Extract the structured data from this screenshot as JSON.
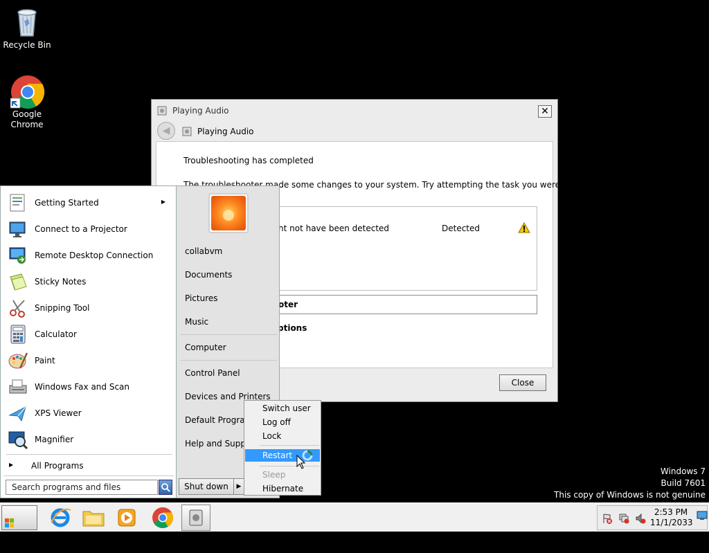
{
  "desktop": {
    "icons": [
      {
        "label": "Recycle Bin"
      },
      {
        "label": "Google Chrome"
      }
    ],
    "watermark": [
      "Windows 7",
      "Build 7601",
      "This copy of Windows is not genuine"
    ]
  },
  "dialog": {
    "title": "Playing Audio",
    "nav_title": "Playing Audio",
    "heading": "Troubleshooting has completed",
    "body_text": "The troubleshooter made some changes to your system. Try attempting the task you were trying",
    "result_issue": "ht not have been detected",
    "result_status": "Detected",
    "option_1": "oter",
    "option_2": "ptions",
    "close_label": "Close",
    "close_x": "✕",
    "back_glyph": "◀"
  },
  "start_menu": {
    "programs": [
      {
        "label": "Getting Started",
        "has_arrow": true
      },
      {
        "label": "Connect to a Projector"
      },
      {
        "label": "Remote Desktop Connection"
      },
      {
        "label": "Sticky Notes"
      },
      {
        "label": "Snipping Tool"
      },
      {
        "label": "Calculator"
      },
      {
        "label": "Paint"
      },
      {
        "label": "Windows Fax and Scan"
      },
      {
        "label": "XPS Viewer"
      },
      {
        "label": "Magnifier"
      }
    ],
    "all_programs": "All Programs",
    "arrow_glyph": "▶",
    "search_placeholder": "Search programs and files",
    "right_items": {
      "user": "collabvm",
      "documents": "Documents",
      "pictures": "Pictures",
      "music": "Music",
      "computer": "Computer",
      "control_panel": "Control Panel",
      "devices": "Devices and Printers",
      "default_programs": "Default Programs",
      "help": "Help and Support"
    },
    "shutdown_label": "Shut down",
    "shutdown_arrow": "▶"
  },
  "shutdown_menu": {
    "switch_user": "Switch user",
    "log_off": "Log off",
    "lock": "Lock",
    "restart": "Restart",
    "sleep": "Sleep",
    "hibernate": "Hibernate"
  },
  "taskbar": {
    "start_label": "Start",
    "time": "2:53 PM",
    "date": "11/1/2033"
  },
  "colors": {
    "highlight": "#3399ff",
    "warning": "#f5c800"
  }
}
